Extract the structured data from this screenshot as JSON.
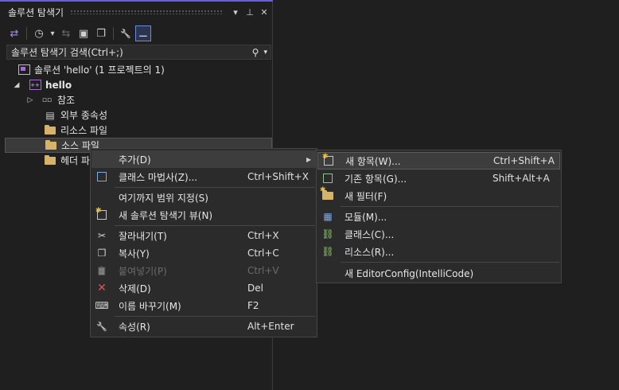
{
  "panel": {
    "title": "솔루션 탐색기",
    "pin_glyph": "▾",
    "pushpin_glyph": "⊥",
    "close_glyph": "✕"
  },
  "toolbar": {
    "icons": [
      "switch-views-icon",
      "history-icon",
      "dropdown-icon",
      "sync-icon",
      "collapse-all-icon",
      "show-all-files-icon",
      "properties-wrench-icon",
      "preview-selected-icon"
    ],
    "glyphs": {
      "switch": "⇄",
      "history": "◷",
      "dropdown": "▾",
      "sync": "⇆",
      "collapse": "▣",
      "showall": "❐",
      "wrench": "🔧",
      "preview": "⚊"
    }
  },
  "search": {
    "placeholder": "솔루션 탐색기 검색(Ctrl+;)",
    "icon_glyph": "⚲",
    "dropdown_glyph": "▾"
  },
  "tree": {
    "solution": "솔루션 'hello' (1 프로젝트의 1)",
    "project": "hello",
    "references": "참조",
    "external": "외부 종속성",
    "resource": "리소스 파일",
    "source": "소스 파일",
    "header": "헤더 파일",
    "glyphs": {
      "expanded": "◢",
      "collapsed": "▷",
      "references": "▫▫",
      "external": "▤"
    }
  },
  "context_menu": {
    "add": "추가(D)",
    "class_wizard": "클래스 마법사(Z)...",
    "class_wizard_sc": "Ctrl+Shift+X",
    "scope": "여기까지 범위 지정(S)",
    "new_view": "새 솔루션 탐색기 뷰(N)",
    "cut": "잘라내기(T)",
    "cut_sc": "Ctrl+X",
    "copy": "복사(Y)",
    "copy_sc": "Ctrl+C",
    "paste": "붙여넣기(P)",
    "paste_sc": "Ctrl+V",
    "delete": "삭제(D)",
    "delete_sc": "Del",
    "rename": "이름 바꾸기(M)",
    "rename_sc": "F2",
    "properties": "속성(R)",
    "properties_sc": "Alt+Enter",
    "glyphs": {
      "arrow": "▶",
      "cut": "✂",
      "copy": "❐",
      "paste": "📋",
      "delete": "✕",
      "rename": "⌨",
      "wrench": "🔧"
    }
  },
  "submenu": {
    "new_item": "새 항목(W)...",
    "new_item_sc": "Ctrl+Shift+A",
    "existing_item": "기존 항목(G)...",
    "existing_item_sc": "Shift+Alt+A",
    "new_filter": "새 필터(F)",
    "module": "모듈(M)...",
    "class": "클래스(C)...",
    "resource": "리소스(R)...",
    "editorconfig": "새 EditorConfig(IntelliCode)"
  },
  "colors": {
    "accent": "#6b5ce7",
    "folder": "#d7b36a",
    "delete": "#e0505a",
    "menu_bg": "#2b2b2b"
  }
}
